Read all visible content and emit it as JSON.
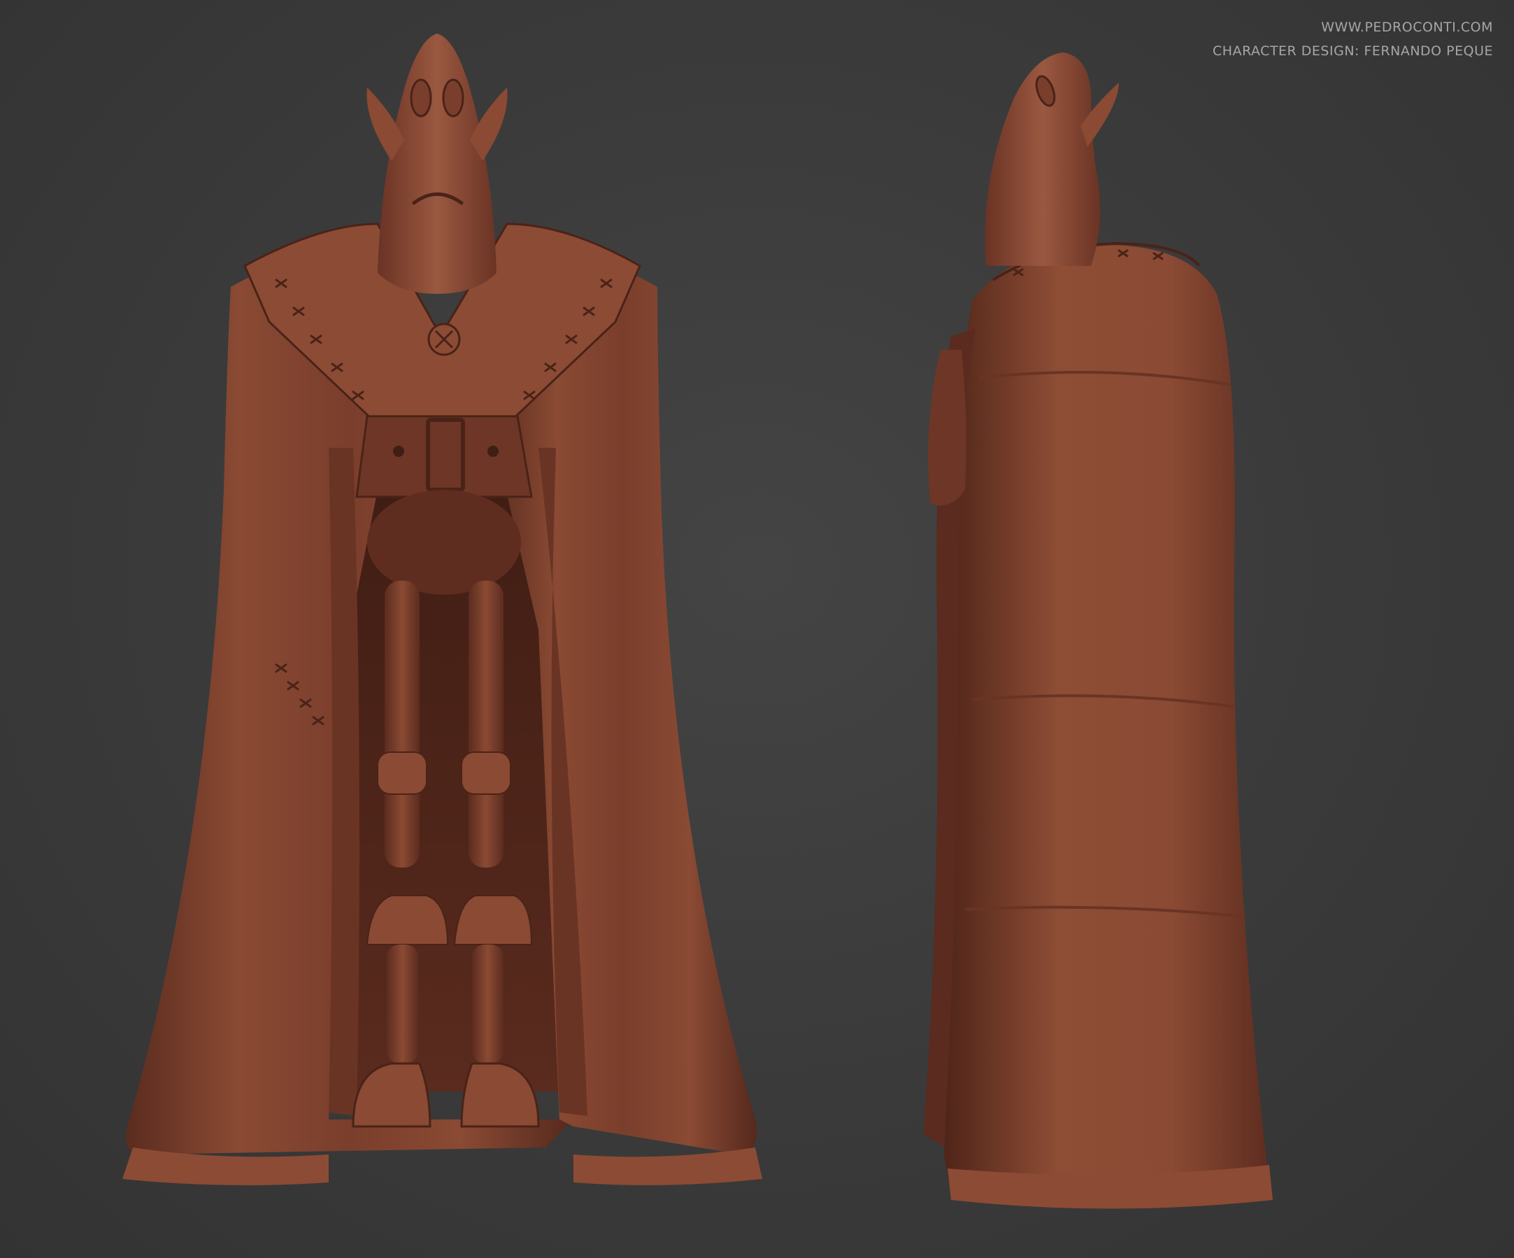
{
  "credits": {
    "website": "WWW.PEDROCONTI.COM",
    "designer": "CHARACTER DESIGN: FERNANDO PEQUE"
  },
  "colors": {
    "background": "#3b3b3b",
    "clay": "#7a3e2c",
    "clay_light": "#9a5840",
    "clay_dark": "#4a2318",
    "text": "#a6a6a6"
  }
}
